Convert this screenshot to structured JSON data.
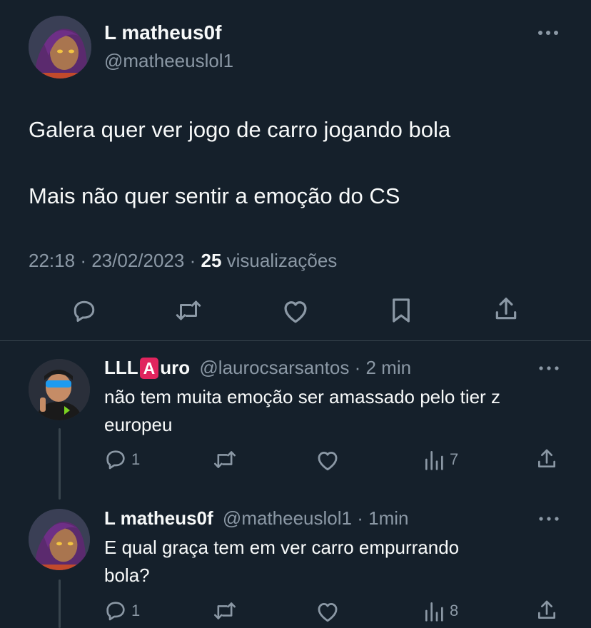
{
  "main_tweet": {
    "author_name": "L matheus0f",
    "author_handle": "@matheeuslol1",
    "text_line1": "Galera quer ver jogo de carro jogando bola",
    "text_line2": "Mais não quer sentir a emoção do CS",
    "time": "22:18",
    "date": "23/02/2023",
    "sep1": "·",
    "sep2": "·",
    "views_count": "25",
    "views_label": "visualizações"
  },
  "replies": [
    {
      "name_prefix": "LLL",
      "name_badge": "A",
      "name_suffix": "uro",
      "handle": "@laurocsarsantos",
      "sep": "·",
      "time": "2 min",
      "text_line1": "não tem muita emoção ser amassado pelo tier z",
      "text_line2": "europeu",
      "reply_count": "1",
      "views_count": "7"
    },
    {
      "name": "L matheus0f",
      "handle": "@matheeuslol1",
      "sep": "·",
      "time": "1min",
      "text_line1": "E qual graça tem em ver carro empurrando",
      "text_line2": "bola?",
      "reply_count": "1",
      "views_count": "8"
    }
  ],
  "colors": {
    "background": "#15202b",
    "text": "#f7f9f9",
    "muted": "#8b98a5",
    "badge": "#e0245e"
  }
}
